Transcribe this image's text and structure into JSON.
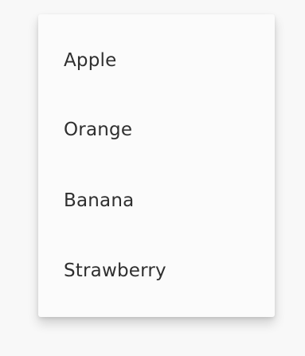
{
  "menu": {
    "items": [
      {
        "label": "Apple"
      },
      {
        "label": "Orange"
      },
      {
        "label": "Banana"
      },
      {
        "label": "Strawberry"
      }
    ]
  }
}
